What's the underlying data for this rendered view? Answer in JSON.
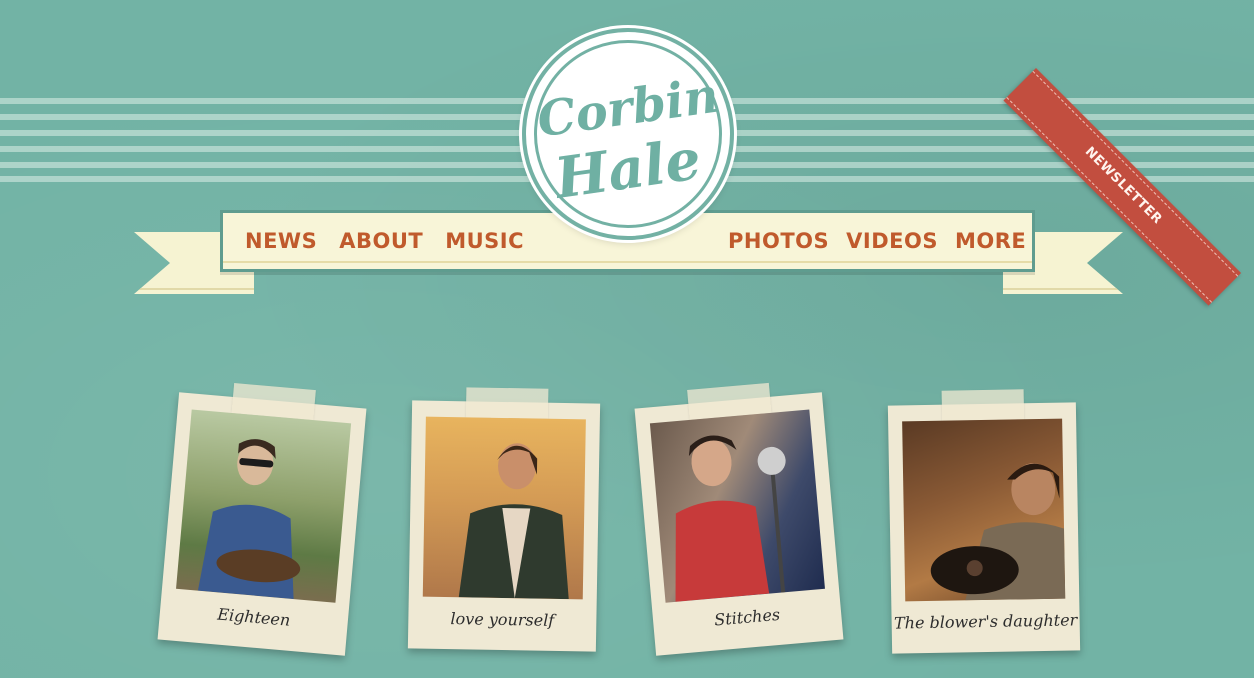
{
  "brand": {
    "line1": "Corbin",
    "line2": "Hale"
  },
  "nav": {
    "left": [
      "NEWS",
      "ABOUT",
      "MUSIC"
    ],
    "right": [
      "PHOTOS",
      "VIDEOS",
      "MORE"
    ]
  },
  "newsletter": {
    "label": "NEWSLETTER"
  },
  "songs": [
    {
      "caption": "Eighteen"
    },
    {
      "caption": "love yourself"
    },
    {
      "caption": "Stitches"
    },
    {
      "caption": "The blower's daughter"
    }
  ],
  "colors": {
    "background": "#72b3a5",
    "nav_text": "#c05a2c",
    "ribbon": "#f8f5d8",
    "newsletter": "#c24e3f"
  }
}
